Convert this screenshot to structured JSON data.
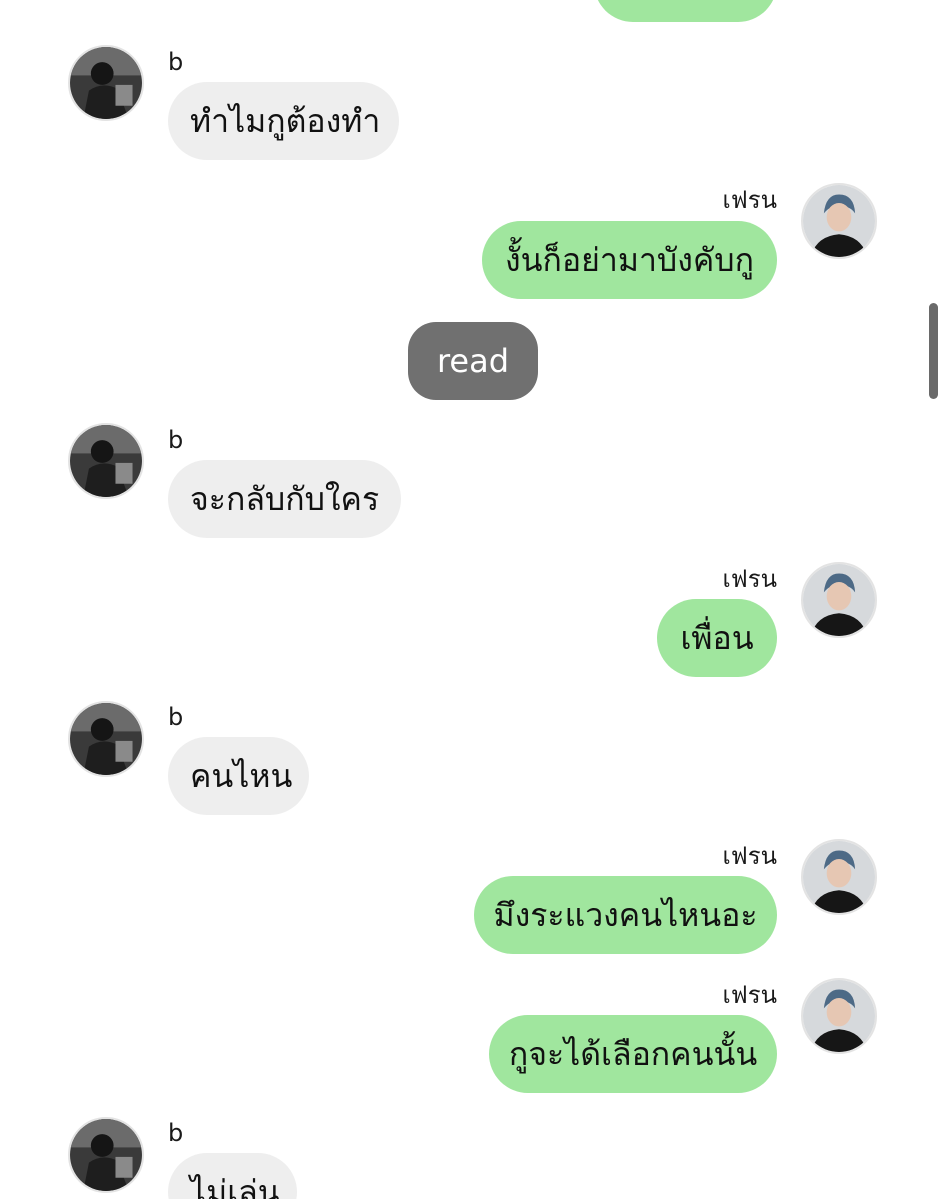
{
  "colors": {
    "incoming_bubble": "#eeeeee",
    "outgoing_bubble": "#a0e69e",
    "read_pill": "#707070",
    "scrollbar": "#6a6a6a"
  },
  "icons": {
    "sender_b_avatar": "grayscale-photo-avatar",
    "sender_fren_avatar": "color-photo-avatar"
  },
  "system": {
    "read_label": "read"
  },
  "messages": [
    {
      "side": "out",
      "sender": "",
      "text": ""
    },
    {
      "side": "in",
      "sender": "b",
      "text": "ทำไมกูต้องทำ"
    },
    {
      "side": "out",
      "sender": "เฟรน",
      "text": "งั้นก็อย่ามาบังคับกู"
    },
    {
      "side": "in",
      "sender": "b",
      "text": "จะกลับกับใคร"
    },
    {
      "side": "out",
      "sender": "เฟรน",
      "text": "เพื่อน"
    },
    {
      "side": "in",
      "sender": "b",
      "text": "คนไหน"
    },
    {
      "side": "out",
      "sender": "เฟรน",
      "text": "มึงระแวงคนไหนอะ"
    },
    {
      "side": "out",
      "sender": "เฟรน",
      "text": "กูจะได้เลือกคนนั้น"
    },
    {
      "side": "in",
      "sender": "b",
      "text": "ไม่เล่น"
    }
  ]
}
